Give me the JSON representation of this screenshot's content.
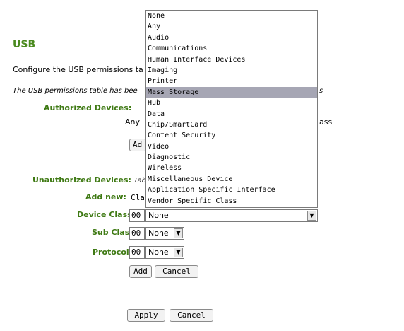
{
  "page": {
    "title": "USB",
    "intro": "Configure the USB permissions ta",
    "note_left": "The USB permissions table has bee",
    "note_right": "s"
  },
  "authorized": {
    "label": "Authorized Devices:",
    "any_text": "Any",
    "any_right": "ass",
    "add_button": "Ad"
  },
  "unauthorized": {
    "label": "Unauthorized Devices:",
    "suffix": "Table",
    "add_new_label": "Add new:",
    "add_new_value": "Cla"
  },
  "device_class": {
    "label": "Device Class:",
    "code": "00",
    "selected": "None"
  },
  "sub_class": {
    "label": "Sub Class:",
    "code": "00",
    "selected": "None"
  },
  "protocol": {
    "label": "Protocol:",
    "code": "00",
    "selected": "None"
  },
  "buttons": {
    "add": "Add",
    "cancel": "Cancel",
    "apply": "Apply",
    "cancel2": "Cancel"
  },
  "dropdown": {
    "selected_index": 7,
    "options": [
      "None",
      "Any",
      "Audio",
      "Communications",
      "Human Interface Devices",
      "Imaging",
      "Printer",
      "Mass Storage",
      "Hub",
      "Data",
      "Chip/SmartCard",
      "Content Security",
      "Video",
      "Diagnostic",
      "Wireless",
      "Miscellaneous Device",
      "Application Specific Interface",
      "Vendor Specific Class"
    ]
  },
  "icons": {
    "select_arrow": "chevron-down-icon"
  }
}
